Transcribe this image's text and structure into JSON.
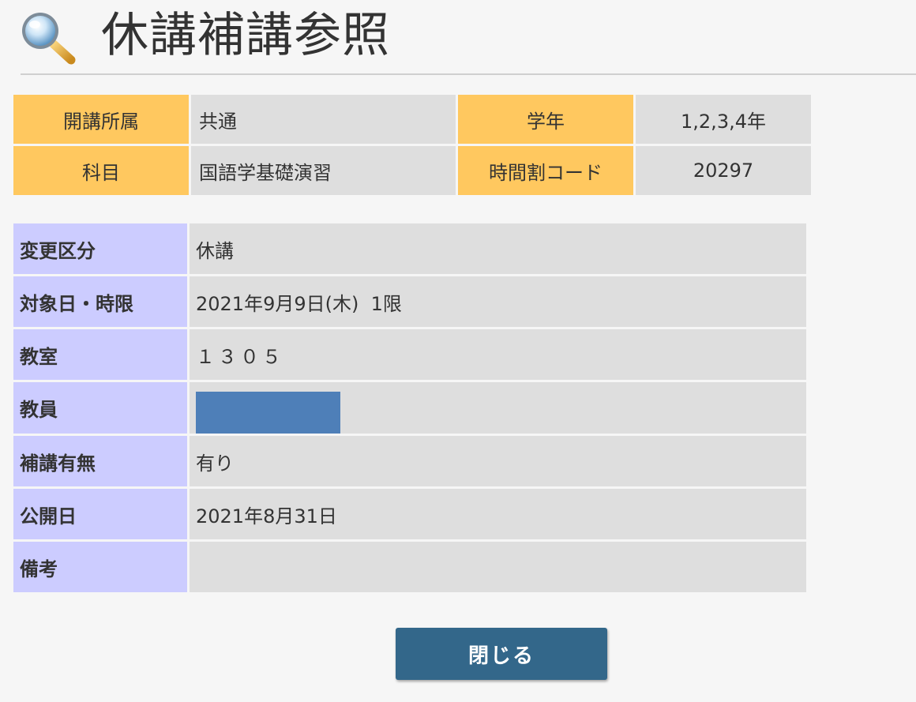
{
  "header": {
    "icon": "search-icon",
    "title": "休講補講参照"
  },
  "summary": {
    "faculty_label": "開講所属",
    "faculty_value": "共通",
    "grade_label": "学年",
    "grade_value": "1,2,3,4年",
    "subject_label": "科目",
    "subject_value": "国語学基礎演習",
    "timetable_code_label": "時間割コード",
    "timetable_code_value": "20297"
  },
  "detail": {
    "rows": [
      {
        "label": "変更区分",
        "value": "休講"
      },
      {
        "label": "対象日・時限",
        "value": "2021年9月9日(木)  1限"
      },
      {
        "label": "教室",
        "value": "１３０５"
      },
      {
        "label": "教員",
        "value": ""
      },
      {
        "label": "補講有無",
        "value": "有り"
      },
      {
        "label": "公開日",
        "value": "2021年8月31日"
      },
      {
        "label": "備考",
        "value": ""
      }
    ]
  },
  "actions": {
    "close_label": "閉じる"
  },
  "colors": {
    "summary_label_bg": "#ffc85f",
    "detail_label_bg": "#ccccff",
    "value_bg": "#dedede",
    "button_bg": "#33678a",
    "redaction": "#4e7fb8"
  }
}
